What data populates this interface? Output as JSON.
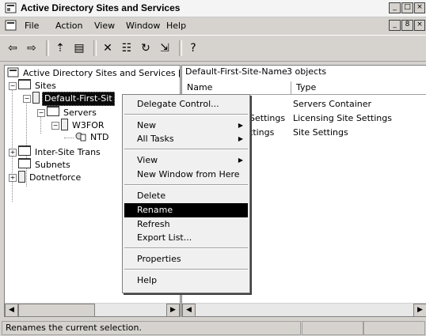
{
  "window": {
    "title": "Active Directory Sites and Services",
    "caption_buttons": [
      "_",
      "□",
      "×"
    ],
    "menu_caption_buttons": [
      "_",
      "8",
      "×"
    ]
  },
  "menubar": {
    "items": [
      {
        "label": "File"
      },
      {
        "label": "Action"
      },
      {
        "label": "View"
      },
      {
        "label": "Window"
      },
      {
        "label": "Help"
      }
    ]
  },
  "toolbar": {
    "buttons": [
      {
        "icon": "back-icon",
        "glyph": "⇦"
      },
      {
        "icon": "forward-icon",
        "glyph": "⇨"
      },
      {
        "icon": "up-level-icon",
        "glyph": "⇡"
      },
      {
        "icon": "show-hide-tree-icon",
        "glyph": "▤"
      },
      {
        "icon": "delete-icon",
        "glyph": "✕"
      },
      {
        "icon": "properties-icon",
        "glyph": "☷"
      },
      {
        "icon": "refresh-icon",
        "glyph": "↻"
      },
      {
        "icon": "export-list-icon",
        "glyph": "⇲"
      },
      {
        "icon": "help-icon",
        "glyph": "?"
      }
    ]
  },
  "tree": {
    "root": "Active Directory Sites and Services [w",
    "sites": "Sites",
    "default_site": "Default-First-Sit",
    "servers": "Servers",
    "w3for": "W3FOR",
    "ntd": "NTD",
    "inter_site": "Inter-Site Trans",
    "subnets": "Subnets",
    "dotnetforce": "Dotnetforce"
  },
  "right_pane": {
    "location": "Default-First-Site-Name",
    "count": "3 objects",
    "columns": [
      "Name",
      "Type"
    ],
    "rows": [
      {
        "name": "",
        "type": "Servers Container"
      },
      {
        "name": "Settings",
        "type": "Licensing Site Settings"
      },
      {
        "name": "ttings",
        "type": "Site Settings"
      }
    ]
  },
  "context_menu": {
    "items": [
      {
        "label": "Delegate Control...",
        "submenu": false
      },
      {
        "label": "New",
        "submenu": true
      },
      {
        "label": "All Tasks",
        "submenu": true
      },
      {
        "label": "View",
        "submenu": true
      },
      {
        "label": "New Window from Here",
        "submenu": false
      },
      {
        "label": "Delete",
        "submenu": false
      },
      {
        "label": "Rename",
        "submenu": false,
        "highlighted": true
      },
      {
        "label": "Refresh",
        "submenu": false
      },
      {
        "label": "Export List...",
        "submenu": false
      },
      {
        "label": "Properties",
        "submenu": false
      },
      {
        "label": "Help",
        "submenu": false
      }
    ],
    "submenu_arrow": "▶"
  },
  "statusbar": {
    "text": "Renames the current selection."
  }
}
